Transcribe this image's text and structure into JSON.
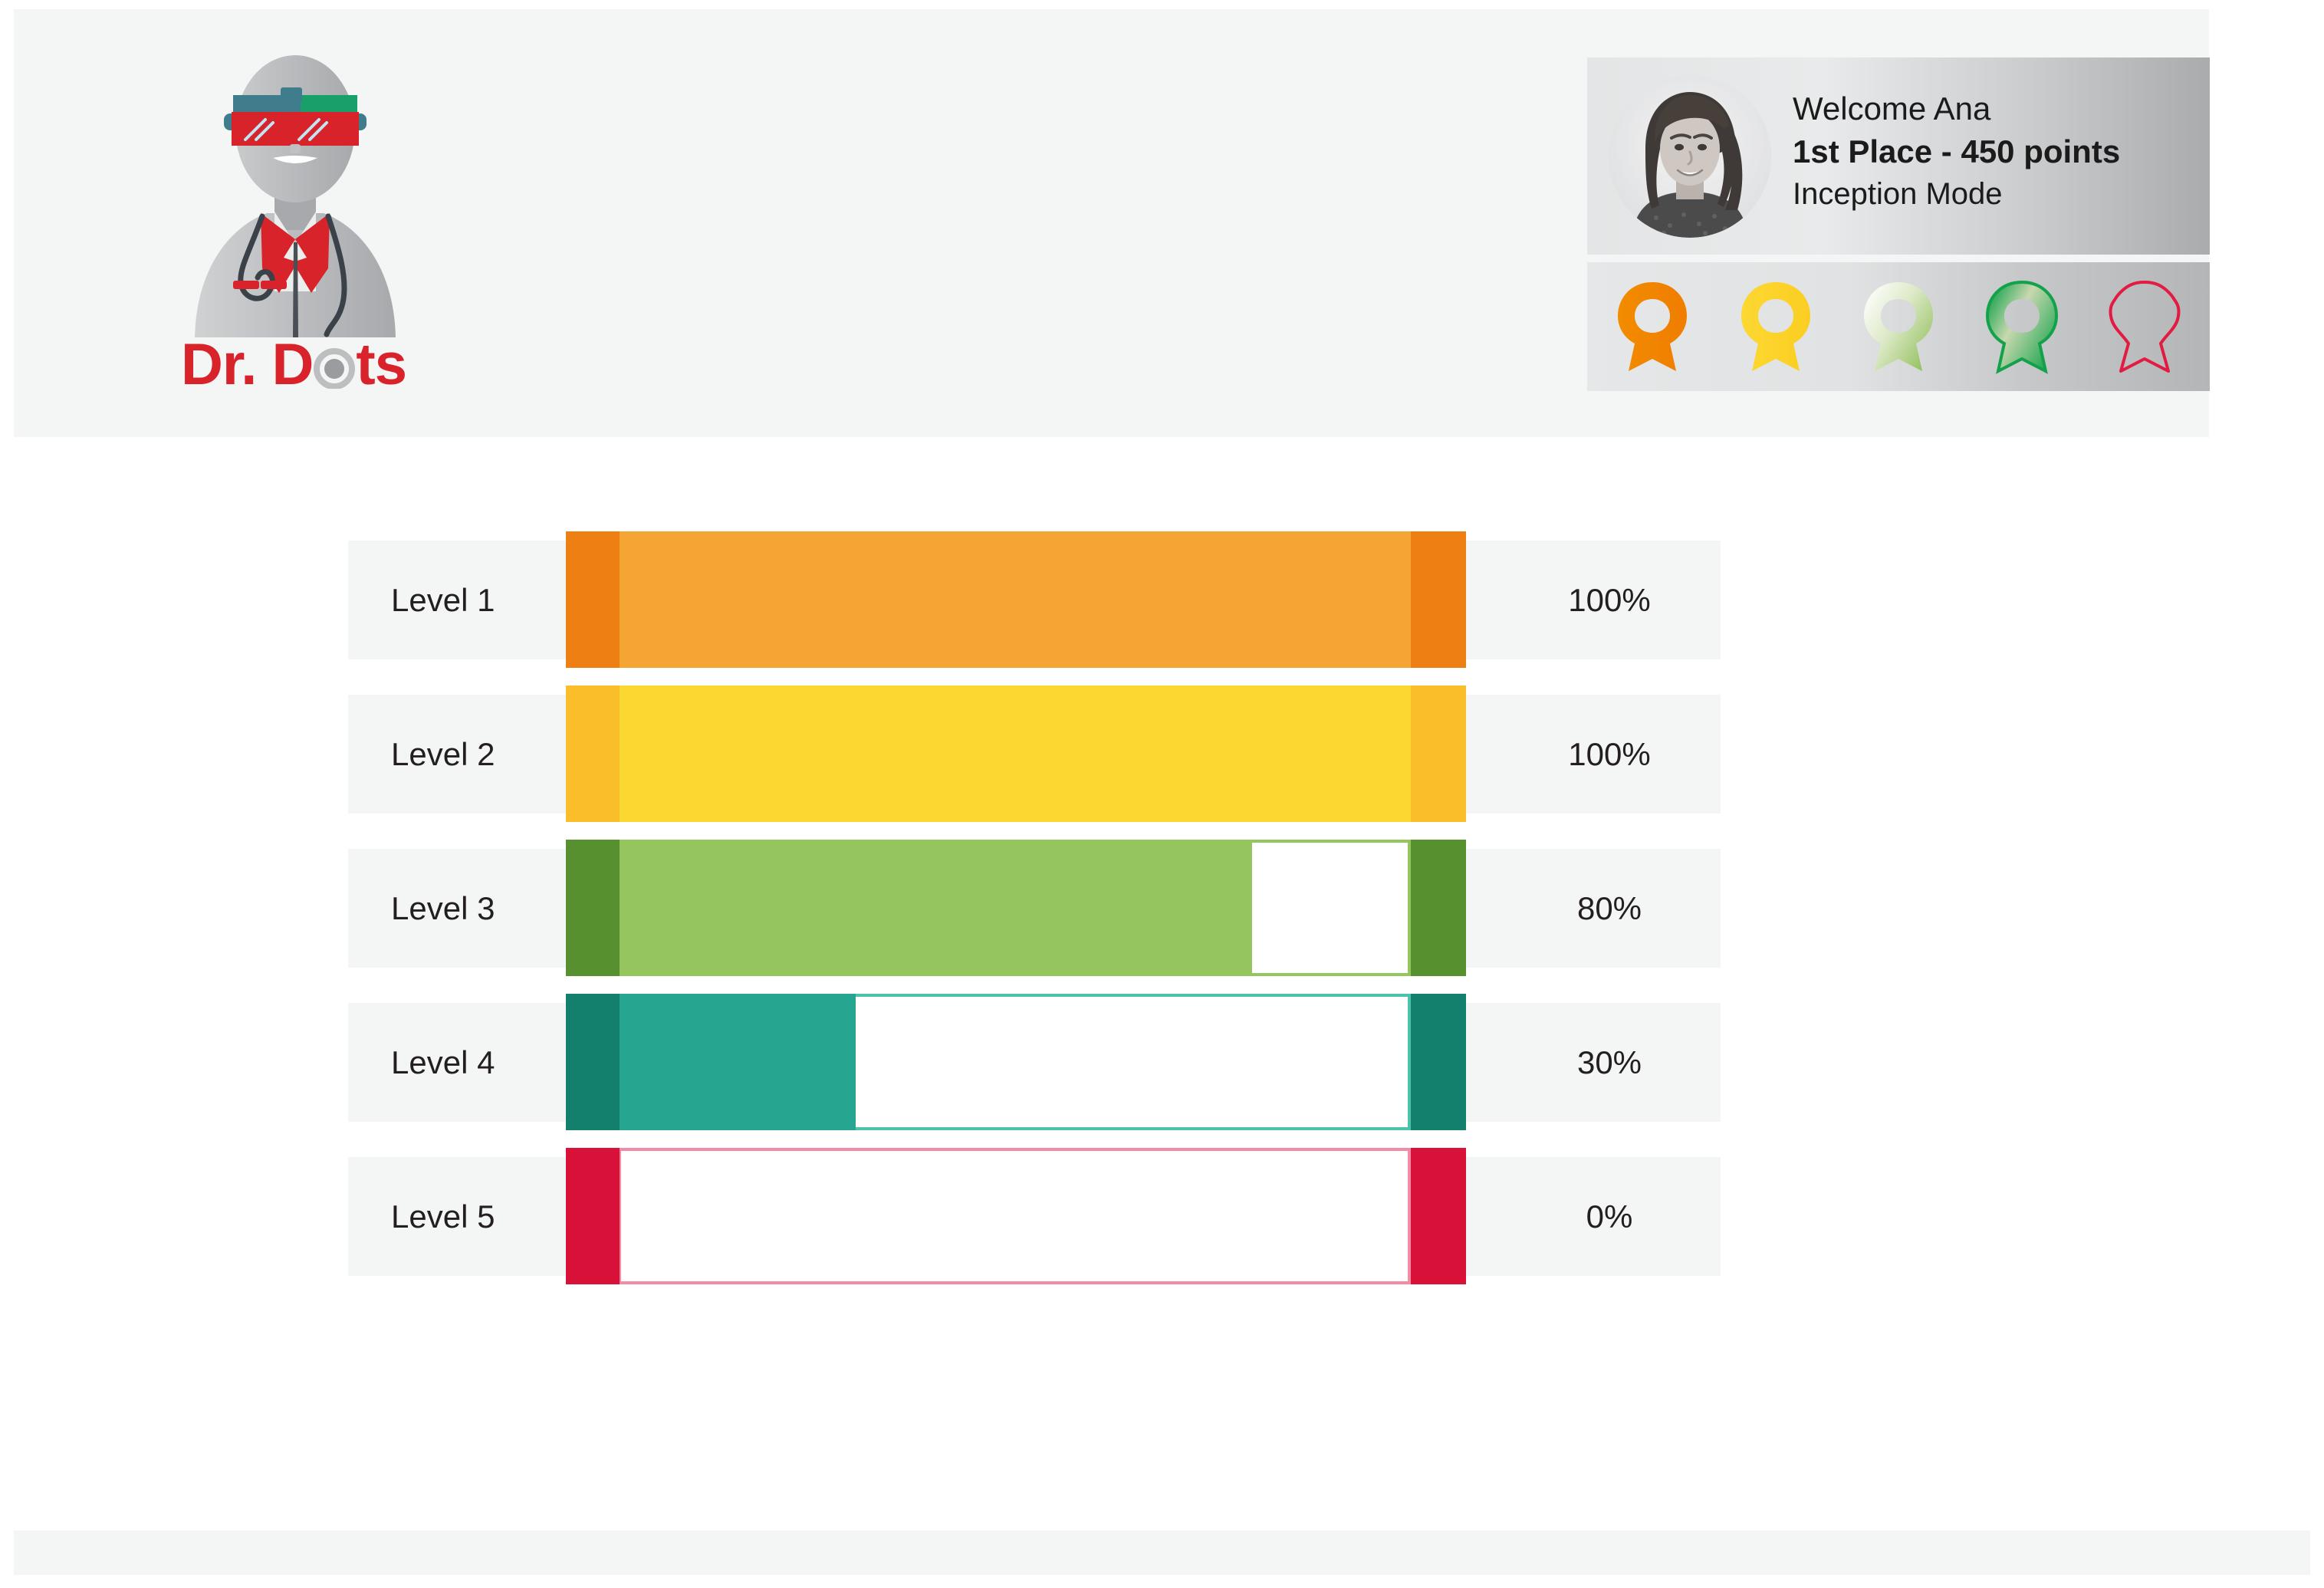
{
  "app": {
    "logo": {
      "wordmark_prefix": "Dr. D",
      "wordmark_suffix": "ts",
      "icon_name": "doctor-vr-goggles-avatar",
      "brand_red": "#d8232a"
    }
  },
  "user_card": {
    "avatar_name": "user-avatar-photo",
    "welcome_line": "Welcome Ana",
    "rank_line": "1st Place - 450 points",
    "mode_line": "Inception Mode"
  },
  "badges": [
    {
      "name": "badge-ribbon-level-1",
      "state": "earned",
      "color": "#f07d00"
    },
    {
      "name": "badge-ribbon-level-2",
      "state": "earned",
      "color": "#fbd831"
    },
    {
      "name": "badge-ribbon-level-3",
      "state": "partial",
      "color": "#97c45f"
    },
    {
      "name": "badge-ribbon-level-4",
      "state": "partial",
      "color": "#13a24a"
    },
    {
      "name": "badge-ribbon-level-5",
      "state": "locked",
      "color": "#e11b41"
    }
  ],
  "progress_rows": [
    {
      "label": "Level 1",
      "percent_label": "100%",
      "percent": 100,
      "cap": "#ee7f12",
      "fill": "#f5a533",
      "track": "#f7b85a"
    },
    {
      "label": "Level 2",
      "percent_label": "100%",
      "percent": 100,
      "cap": "#fbbe2b",
      "fill": "#fbd831",
      "track": "#fcd95a"
    },
    {
      "label": "Level 3",
      "percent_label": "80%",
      "percent": 80,
      "cap": "#57902f",
      "fill": "#95c55f",
      "track": "#95c55f"
    },
    {
      "label": "Level 4",
      "percent_label": "30%",
      "percent": 30,
      "cap": "#12806c",
      "fill": "#26a690",
      "track": "#4cc2ab"
    },
    {
      "label": "Level 5",
      "percent_label": "0%",
      "percent": 0,
      "cap": "#d81138",
      "fill": "#d81138",
      "track": "#f48ba5"
    }
  ],
  "chart_data": {
    "type": "bar",
    "title": "",
    "xlabel": "",
    "ylabel": "",
    "orientation": "horizontal",
    "categories": [
      "Level 1",
      "Level 2",
      "Level 3",
      "Level 4",
      "Level 5"
    ],
    "values": [
      100,
      100,
      80,
      30,
      0
    ],
    "value_labels": [
      "100%",
      "100%",
      "80%",
      "30%",
      "0%"
    ],
    "xlim": [
      0,
      100
    ],
    "grid": false,
    "legend": "none",
    "series_colors": [
      "#f5a533",
      "#fbd831",
      "#95c55f",
      "#26a690",
      "#d81138"
    ]
  }
}
